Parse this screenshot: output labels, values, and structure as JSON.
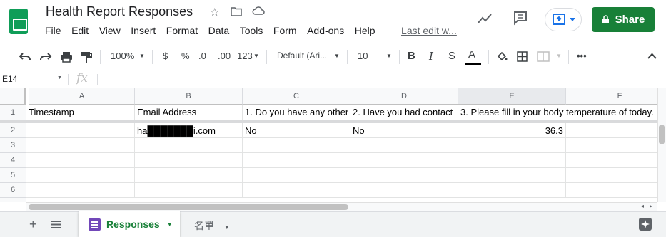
{
  "header": {
    "title": "Health Report Responses",
    "menu": [
      "File",
      "Edit",
      "View",
      "Insert",
      "Format",
      "Data",
      "Tools",
      "Form",
      "Add-ons",
      "Help"
    ],
    "last_edit": "Last edit w...",
    "share_label": "Share"
  },
  "toolbar": {
    "zoom": "100%",
    "currency": "$",
    "percent": "%",
    "dec_decrease": ".0",
    "dec_increase": ".00",
    "more_formats": "123",
    "font": "Default (Ari...",
    "font_size": "10",
    "bold": "B",
    "italic": "I",
    "strike": "S",
    "text_color": "A",
    "more": "•••"
  },
  "formula_bar": {
    "cell_ref": "E14",
    "fx": "fx",
    "value": ""
  },
  "grid": {
    "columns": [
      "A",
      "B",
      "C",
      "D",
      "E",
      "F"
    ],
    "selected_column": "E",
    "rows": [
      "1",
      "2",
      "3",
      "4",
      "5",
      "6"
    ],
    "row1": [
      "Timestamp",
      "Email Address",
      "1. Do you have any other",
      "2. Have you had contact",
      "3. Please fill in your body temperature of today.",
      ""
    ],
    "row2": [
      "",
      "ha███████i.com",
      "No",
      "No",
      "36.3",
      ""
    ]
  },
  "sheets": {
    "active": "Responses",
    "other": "名單"
  },
  "colors": {
    "accent_green": "#188038",
    "forms_purple": "#7248b9",
    "grid_line": "#e2e3e3"
  }
}
